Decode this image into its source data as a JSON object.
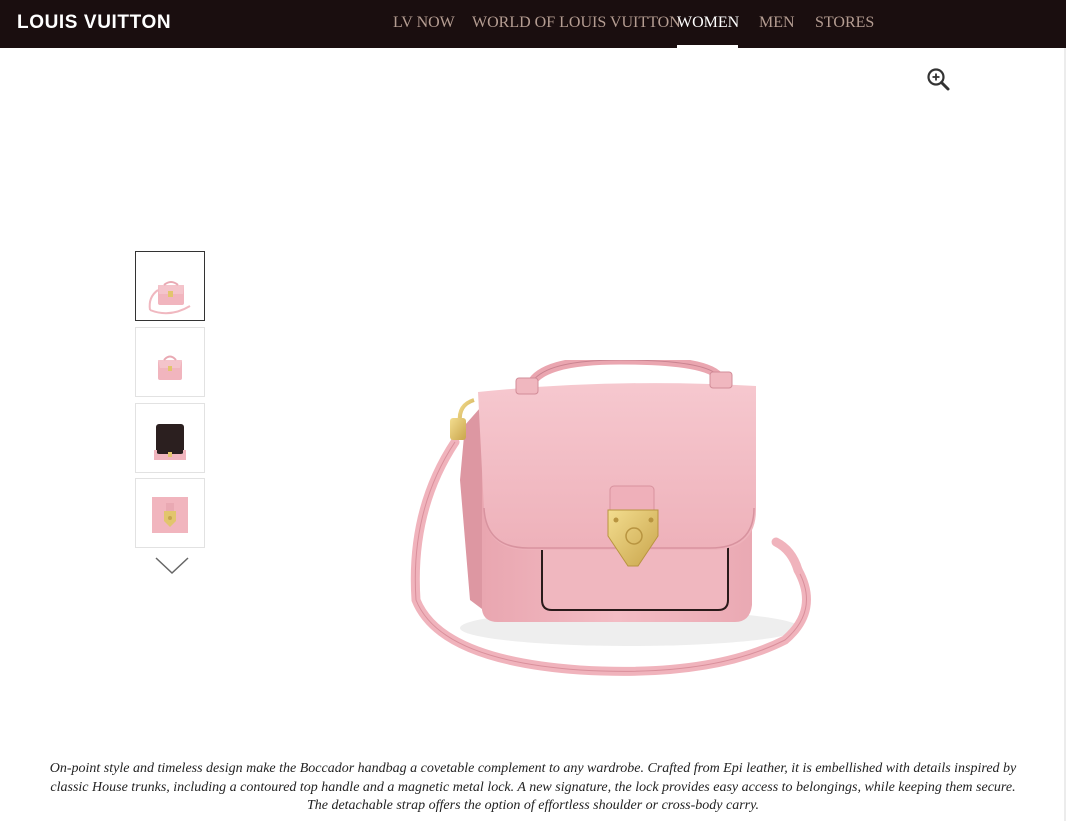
{
  "header": {
    "logo": "LOUIS VUITTON",
    "nav": [
      {
        "label": "LV NOW"
      },
      {
        "label": "WORLD OF LOUIS VUITTON"
      },
      {
        "label": "WOMEN",
        "active": true
      },
      {
        "label": "MEN"
      },
      {
        "label": "STORES"
      }
    ]
  },
  "gallery": {
    "zoom_icon": "zoom-in-icon",
    "thumbnails": [
      {
        "view": "front-with-strap",
        "selected": true
      },
      {
        "view": "side"
      },
      {
        "view": "interior-open"
      },
      {
        "view": "lock-detail"
      }
    ],
    "next_icon": "chevron-down-icon"
  },
  "product": {
    "description": "On-point style and timeless design make the Boccador handbag a covetable complement to any wardrobe. Crafted from Epi leather, it is embellished with details inspired by classic House trunks, including a contoured top handle and a magnetic metal lock. A new signature, the lock provides easy access to belongings, while keeping them secure. The detachable strap offers the option of effortless shoulder or cross-body carry."
  },
  "colors": {
    "header_bg": "#1a0e0f",
    "nav_text": "#b59d92",
    "nav_active": "#ffffff",
    "bag_pink": "#f1b5be",
    "hardware_gold": "#e2c56d"
  }
}
